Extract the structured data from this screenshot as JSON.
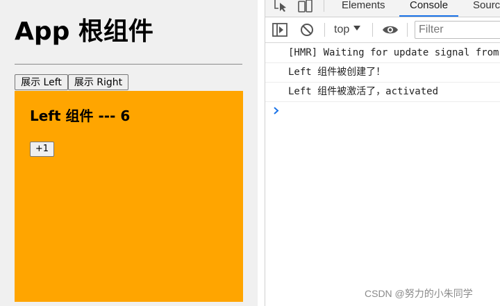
{
  "app": {
    "title": "App 根组件",
    "buttons": {
      "show_left": "展示 Left",
      "show_right": "展示 Right"
    },
    "left_component": {
      "title": "Left 组件 --- 6",
      "increment_label": "+1",
      "background_color": "#ffa500"
    }
  },
  "devtools": {
    "tabs": [
      {
        "label": "Elements",
        "active": false
      },
      {
        "label": "Console",
        "active": true
      },
      {
        "label": "Sources",
        "active": false
      }
    ],
    "toolbar": {
      "context": "top",
      "filter_placeholder": "Filter"
    },
    "console_lines": [
      "[HMR] Waiting for update signal from WDS...",
      "Left 组件被创建了！",
      "Left 组件被激活了，activated"
    ],
    "accent_color": "#1a73e8"
  },
  "watermark": "CSDN @努力的小朱同学"
}
